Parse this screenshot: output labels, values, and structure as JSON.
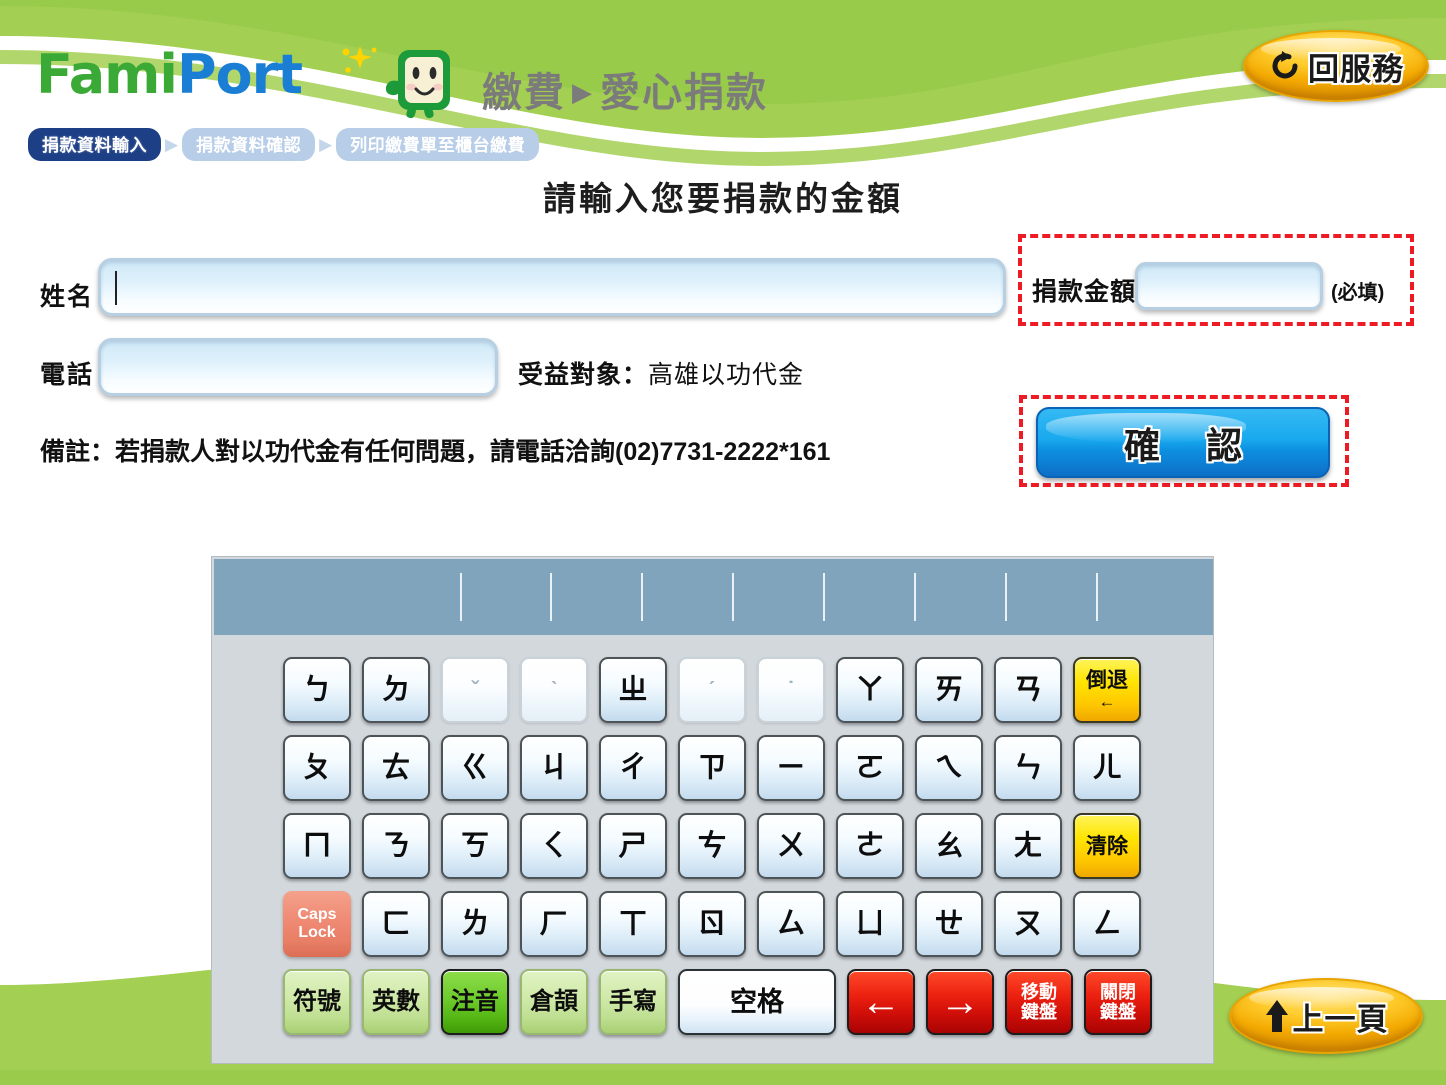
{
  "header": {
    "logo_fami": "FamiPort",
    "logo_part1": "Fami",
    "logo_part2": "Port",
    "title_section": "繳費",
    "title_arrow": "▶",
    "title_page": "愛心捐款",
    "back_service_label": "回服務",
    "back_service_icon": "reload-icon"
  },
  "breadcrumb": {
    "separator": "▶",
    "steps": [
      {
        "label": "捐款資料輸入",
        "state": "active"
      },
      {
        "label": "捐款資料確認",
        "state": "inactive"
      },
      {
        "label": "列印繳費單至櫃台繳費",
        "state": "inactive"
      }
    ]
  },
  "main": {
    "heading": "請輸入您要捐款的金額",
    "name_label": "姓名",
    "name_value": "",
    "phone_label": "電話",
    "phone_value": "",
    "beneficiary_label": "受益對象：",
    "beneficiary_value": "高雄以功代金",
    "remark": "備註：若捐款人對以功代金有任何問題，請電話洽詢(02)7731-2222*161",
    "amount_label": "捐款金額",
    "amount_value": "",
    "amount_required_note": "(必填)",
    "confirm_label": "確 認"
  },
  "footer": {
    "prev_page_label": "上一頁",
    "prev_page_icon": "arrow-up-icon"
  },
  "keyboard": {
    "candidate_separators": 8,
    "rows": [
      [
        {
          "label": "ㄅ",
          "style": "normal"
        },
        {
          "label": "ㄉ",
          "style": "normal"
        },
        {
          "label": "ˇ",
          "style": "dim"
        },
        {
          "label": "ˋ",
          "style": "dim"
        },
        {
          "label": "ㄓ",
          "style": "normal"
        },
        {
          "label": "ˊ",
          "style": "dim"
        },
        {
          "label": "˙",
          "style": "dim"
        },
        {
          "label": "ㄚ",
          "style": "normal"
        },
        {
          "label": "ㄞ",
          "style": "normal"
        },
        {
          "label": "ㄢ",
          "style": "normal"
        },
        {
          "label": "倒退",
          "sub": "←",
          "style": "yellow"
        }
      ],
      [
        {
          "label": "ㄆ",
          "style": "normal"
        },
        {
          "label": "ㄊ",
          "style": "normal"
        },
        {
          "label": "ㄍ",
          "style": "normal"
        },
        {
          "label": "ㄐ",
          "style": "normal"
        },
        {
          "label": "ㄔ",
          "style": "normal"
        },
        {
          "label": "ㄗ",
          "style": "normal"
        },
        {
          "label": "ㄧ",
          "style": "normal"
        },
        {
          "label": "ㄛ",
          "style": "normal"
        },
        {
          "label": "ㄟ",
          "style": "normal"
        },
        {
          "label": "ㄣ",
          "style": "normal"
        },
        {
          "label": "ㄦ",
          "style": "normal"
        }
      ],
      [
        {
          "label": "ㄇ",
          "style": "normal"
        },
        {
          "label": "ㄋ",
          "style": "normal"
        },
        {
          "label": "ㄎ",
          "style": "normal"
        },
        {
          "label": "ㄑ",
          "style": "normal"
        },
        {
          "label": "ㄕ",
          "style": "normal"
        },
        {
          "label": "ㄘ",
          "style": "normal"
        },
        {
          "label": "ㄨ",
          "style": "normal"
        },
        {
          "label": "ㄜ",
          "style": "normal"
        },
        {
          "label": "ㄠ",
          "style": "normal"
        },
        {
          "label": "ㄤ",
          "style": "normal"
        },
        {
          "label": "清除",
          "style": "yellow"
        }
      ],
      [
        {
          "label": "Caps",
          "sub": "Lock",
          "style": "caps"
        },
        {
          "label": "ㄈ",
          "style": "normal"
        },
        {
          "label": "ㄌ",
          "style": "normal"
        },
        {
          "label": "ㄏ",
          "style": "normal"
        },
        {
          "label": "ㄒ",
          "style": "normal"
        },
        {
          "label": "ㄖ",
          "style": "normal"
        },
        {
          "label": "ㄙ",
          "style": "normal"
        },
        {
          "label": "ㄩ",
          "style": "normal"
        },
        {
          "label": "ㄝ",
          "style": "normal"
        },
        {
          "label": "ㄡ",
          "style": "normal"
        },
        {
          "label": "ㄥ",
          "style": "normal"
        }
      ],
      [
        {
          "label": "符號",
          "style": "green"
        },
        {
          "label": "英數",
          "style": "green"
        },
        {
          "label": "注音",
          "style": "green-on"
        },
        {
          "label": "倉頡",
          "style": "green"
        },
        {
          "label": "手寫",
          "style": "green"
        },
        {
          "label": "空格",
          "style": "space"
        },
        {
          "label": "←",
          "style": "red-arrow"
        },
        {
          "label": "→",
          "style": "red-arrow"
        },
        {
          "label": "移動",
          "sub": "鍵盤",
          "style": "red"
        },
        {
          "label": "關閉",
          "sub": "鍵盤",
          "style": "red"
        }
      ]
    ]
  },
  "colors": {
    "green_band": "#a3cf52",
    "logo_green": "#3aa935",
    "logo_blue": "#1a7fd4",
    "crumb_active": "#1d3f86",
    "crumb_inactive": "#b7cde8",
    "highlight_red": "#ee1b24",
    "confirm_blue": "#19a9ee",
    "candidate_bar": "#7fa4bb",
    "keyboard_bg": "#d3d8dd",
    "accent_orange": "#ffcd2e"
  }
}
